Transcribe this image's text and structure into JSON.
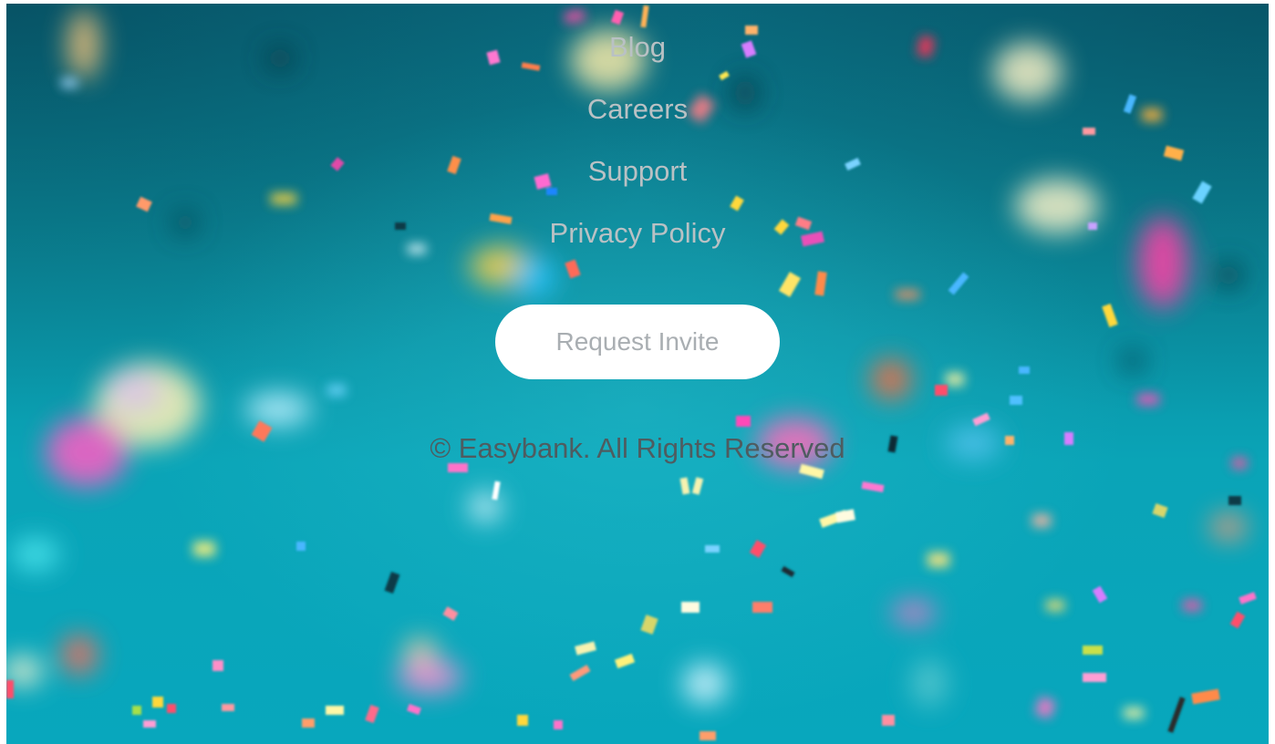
{
  "footer": {
    "links": [
      {
        "label": "Blog"
      },
      {
        "label": "Careers"
      },
      {
        "label": "Support"
      },
      {
        "label": "Privacy Policy"
      }
    ],
    "cta_label": "Request Invite",
    "copyright": "© Easybank. All Rights Reserved"
  },
  "colors": {
    "link_text": "#b9c1c4",
    "button_bg": "#ffffff",
    "button_text": "#a9aeb2",
    "copyright_text": "#4e5c60",
    "background_teal": "#0aa4b7"
  },
  "background": {
    "image": "confetti-photo"
  }
}
